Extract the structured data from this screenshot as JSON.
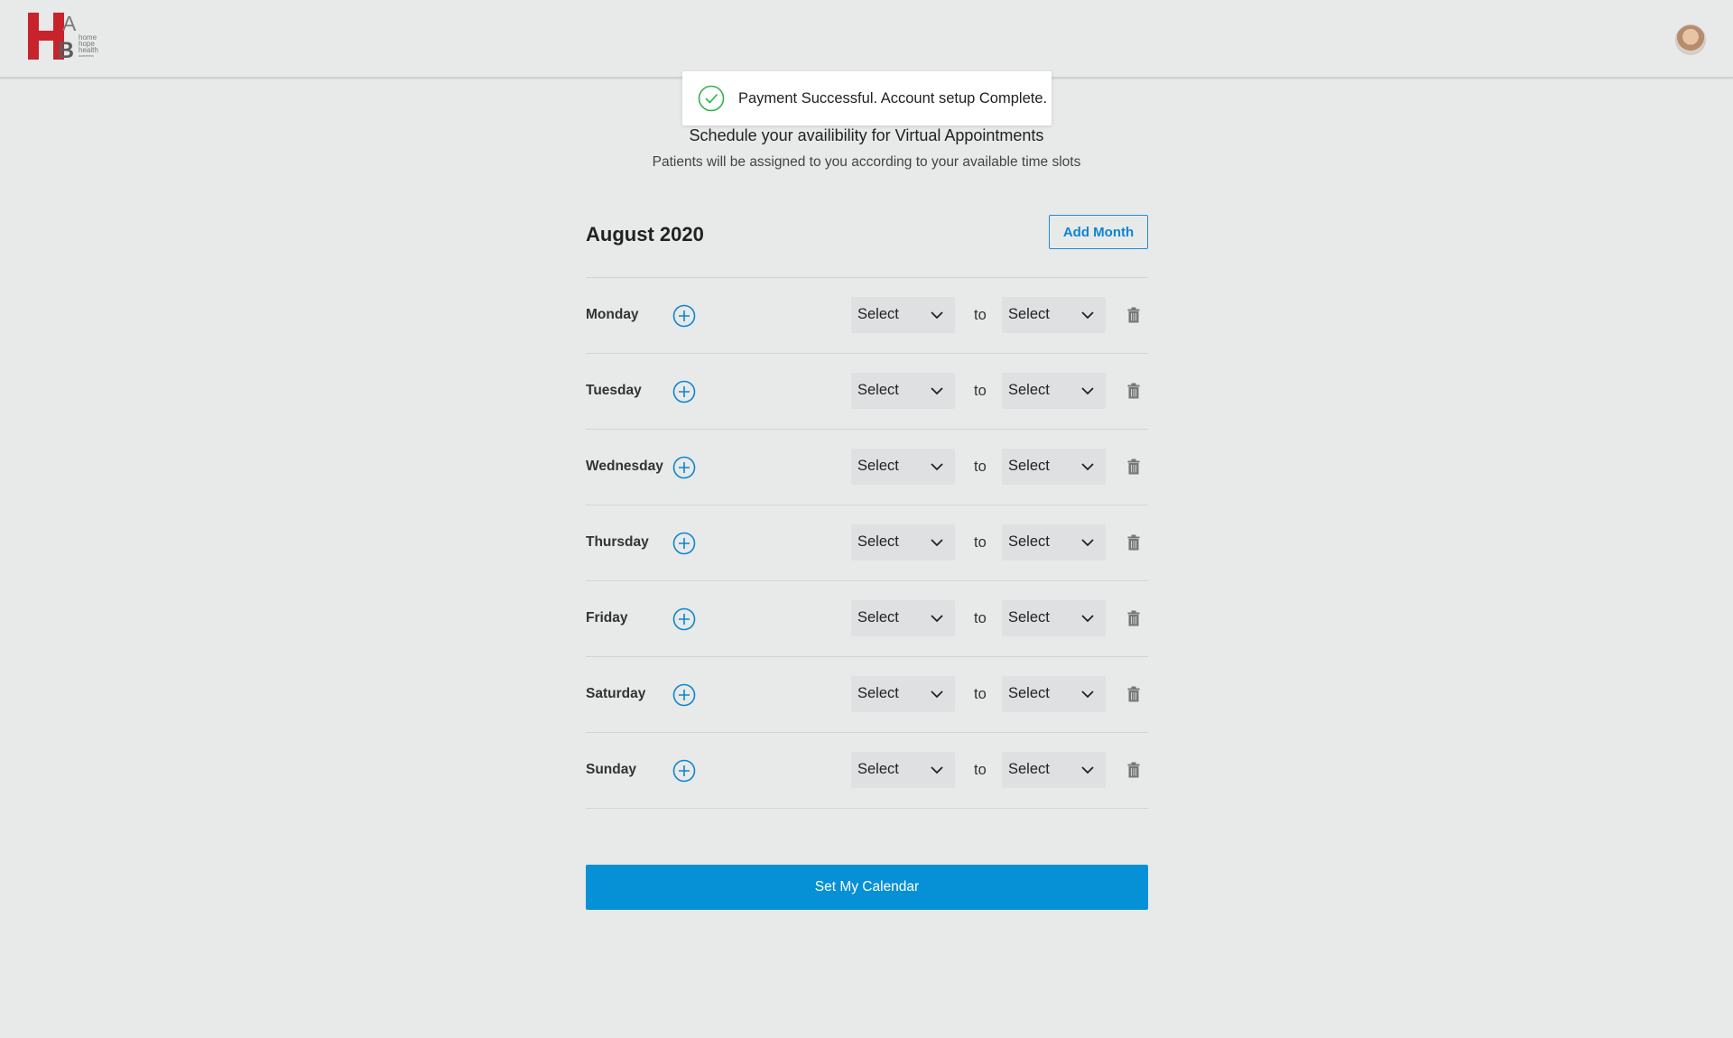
{
  "header": {
    "logo": {
      "letters": "HBA",
      "words": [
        "home",
        "hope",
        "health",
        "awareness"
      ],
      "colors": {
        "primary": "#c8232c",
        "secondary": "#6f6f6f"
      }
    },
    "avatar_icon": "user-avatar"
  },
  "toast": {
    "icon": "check-circle-icon",
    "message": "Payment Successful. Account setup Complete.",
    "color": "#2fb34a"
  },
  "page": {
    "title": "Schedule your availibility for Virtual Appointments",
    "subtitle": "Patients will be assigned to you according to your available time slots"
  },
  "calendar": {
    "month": "August 2020",
    "add_month_label": "Add Month",
    "to_label": "to",
    "days": [
      {
        "name": "Monday",
        "from": "Select",
        "to": "Select"
      },
      {
        "name": "Tuesday",
        "from": "Select",
        "to": "Select"
      },
      {
        "name": "Wednesday",
        "from": "Select",
        "to": "Select"
      },
      {
        "name": "Thursday",
        "from": "Select",
        "to": "Select"
      },
      {
        "name": "Friday",
        "from": "Select",
        "to": "Select"
      },
      {
        "name": "Saturday",
        "from": "Select",
        "to": "Select"
      },
      {
        "name": "Sunday",
        "from": "Select",
        "to": "Select"
      }
    ],
    "submit_label": "Set My Calendar"
  },
  "colors": {
    "accent": "#0690d6",
    "background": "#e8e9e9",
    "select_bg": "#dfe0e1"
  }
}
